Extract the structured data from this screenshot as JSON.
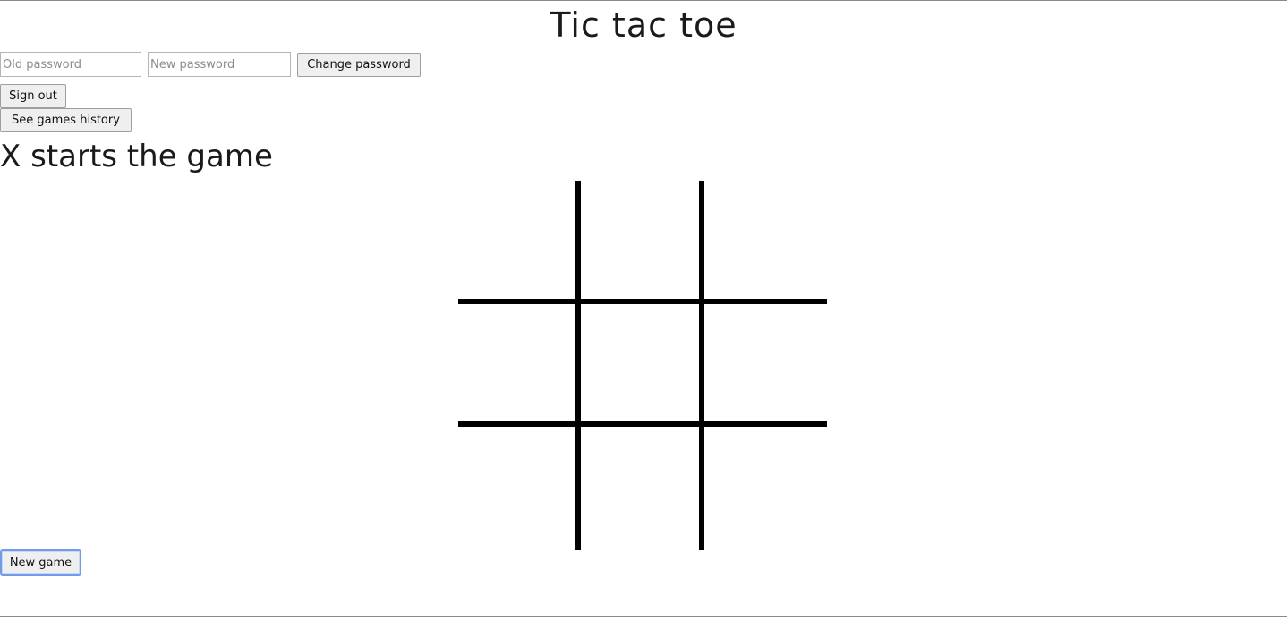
{
  "header": {
    "title": "Tic tac toe"
  },
  "account": {
    "old_password_placeholder": "Old password",
    "new_password_placeholder": "New password",
    "old_password_value": "",
    "new_password_value": "",
    "change_password_label": "Change password",
    "sign_out_label": "Sign out",
    "games_history_label": "See games history"
  },
  "game": {
    "status": "X starts the game",
    "cells": [
      "",
      "",
      "",
      "",
      "",
      "",
      "",
      "",
      ""
    ],
    "new_game_label": "New game"
  },
  "colors": {
    "grid_lines": "#000000",
    "focus_ring": "#6f9be8",
    "button_background": "#efefef"
  }
}
